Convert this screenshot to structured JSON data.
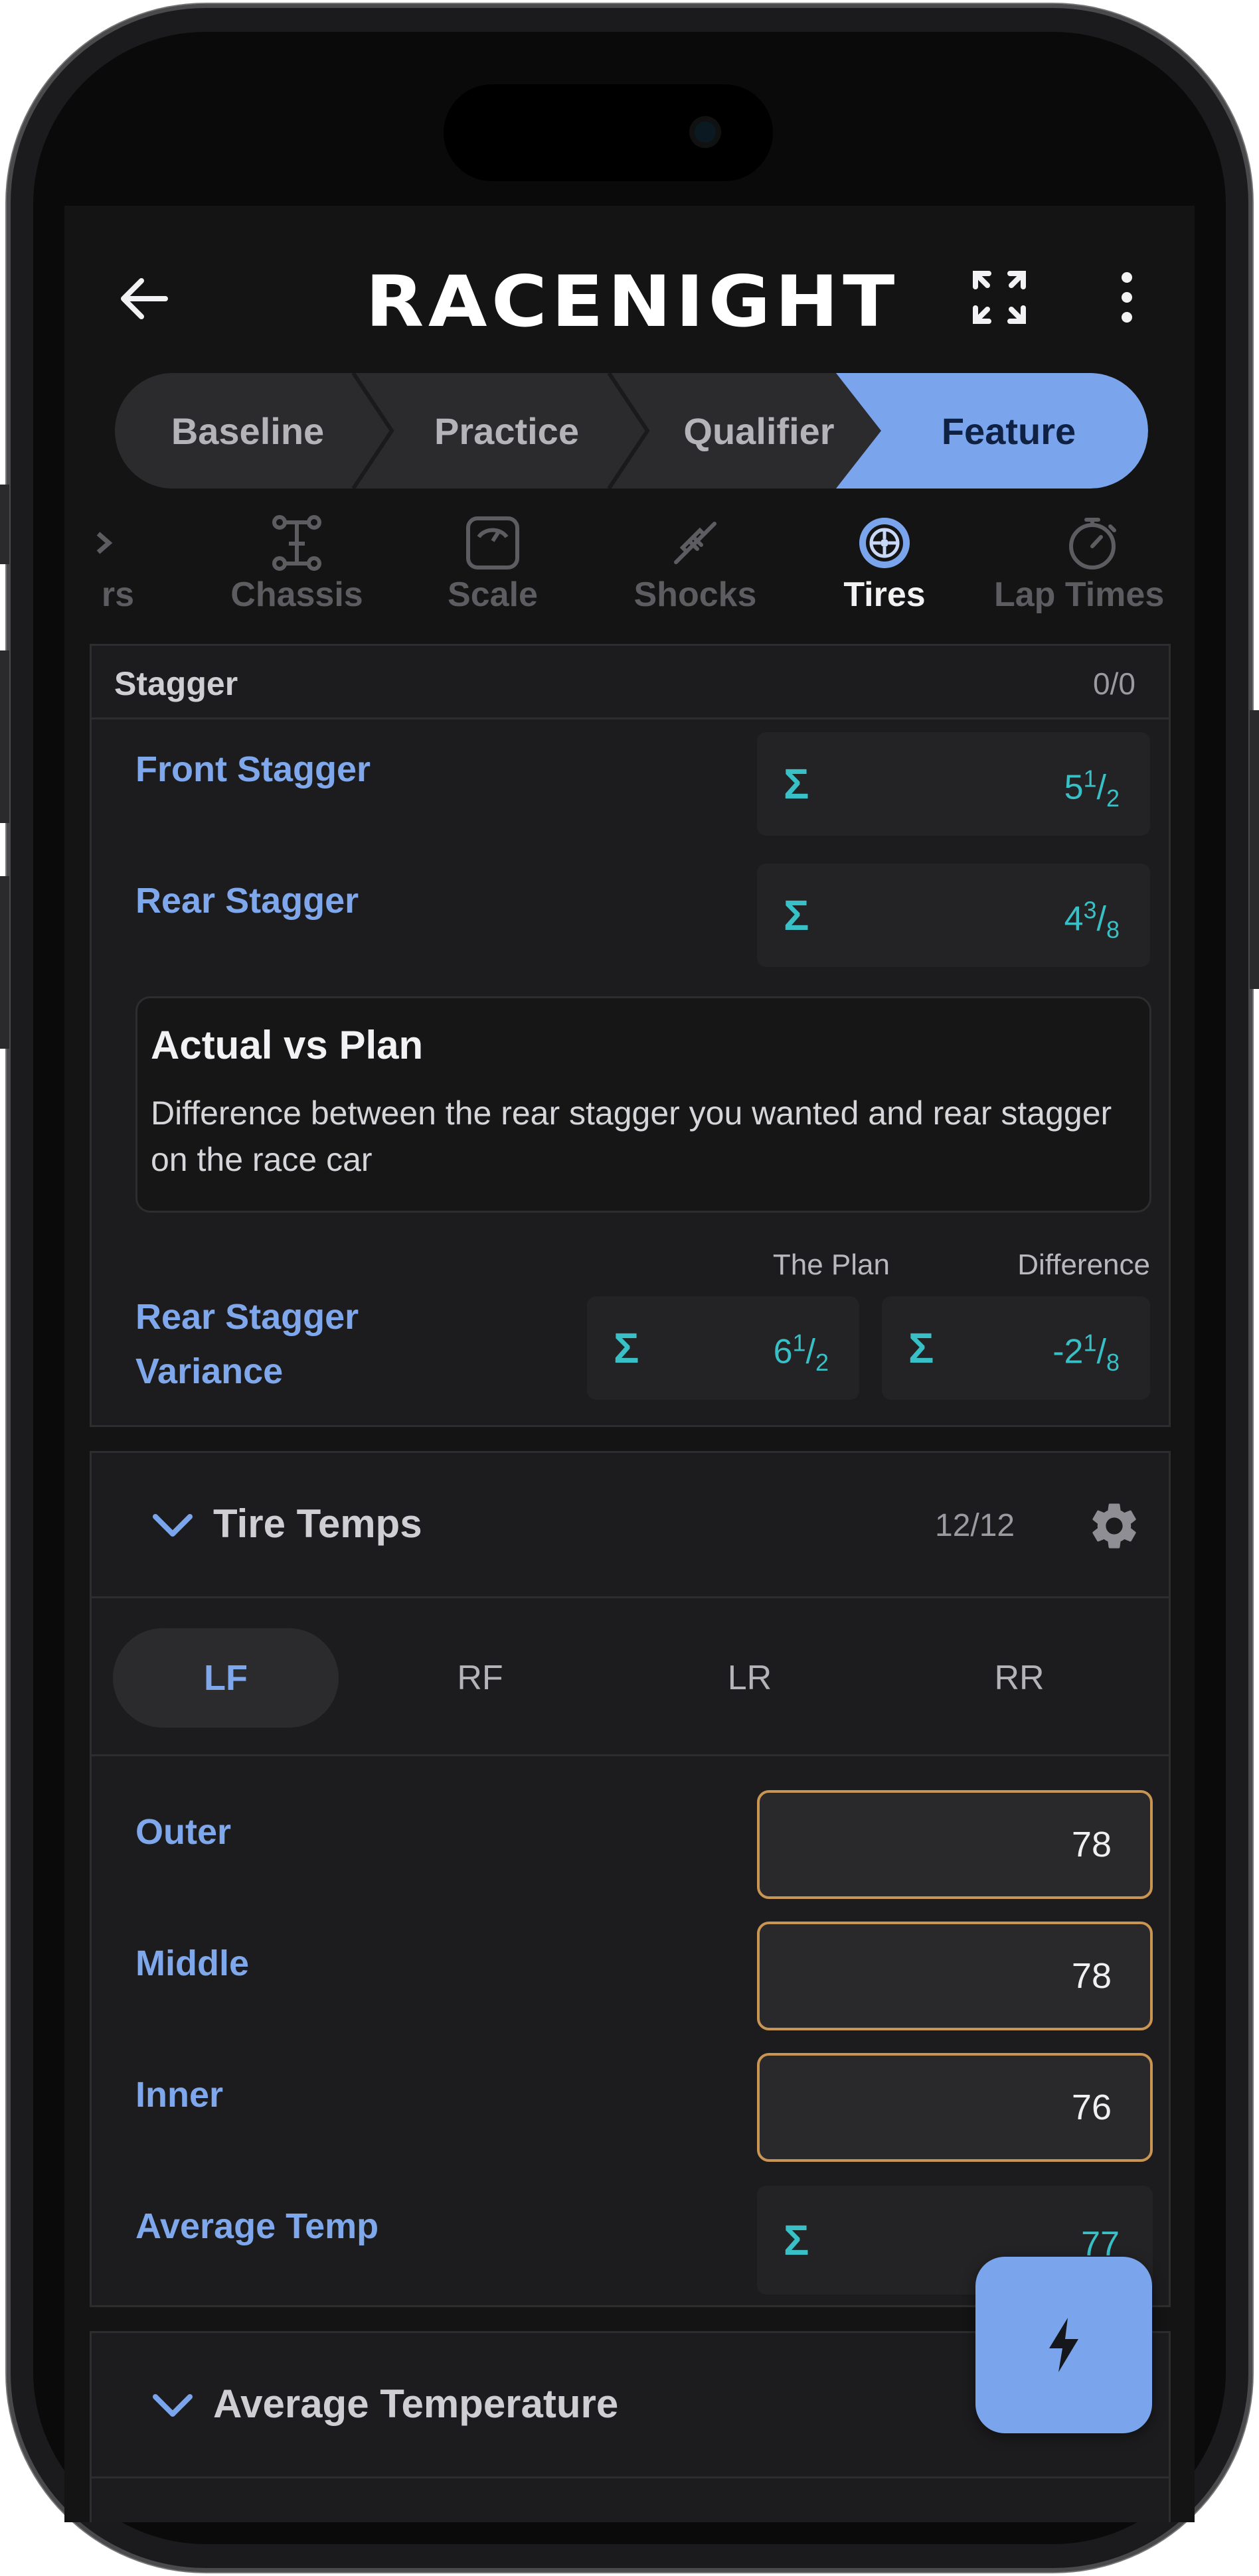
{
  "header": {
    "logo_text": "RACENIGHT",
    "back_icon": "arrow-left-icon",
    "expand_icon": "fullscreen-icon",
    "more_icon": "more-vertical-icon"
  },
  "breadcrumb": {
    "steps": [
      "Baseline",
      "Practice",
      "Qualifier",
      "Feature"
    ],
    "active": "Feature"
  },
  "tabs": {
    "items": [
      {
        "label": "rs",
        "icon": "chevron-right-icon"
      },
      {
        "label": "Chassis",
        "icon": "chassis-icon"
      },
      {
        "label": "Scale",
        "icon": "scale-icon"
      },
      {
        "label": "Shocks",
        "icon": "shock-icon"
      },
      {
        "label": "Tires",
        "icon": "tire-icon"
      },
      {
        "label": "Lap Times",
        "icon": "stopwatch-icon"
      }
    ],
    "active": "Tires"
  },
  "stagger": {
    "title": "Stagger",
    "count": "0/0",
    "front": {
      "label": "Front Stagger",
      "whole": "5",
      "num": "1",
      "den": "2"
    },
    "rear": {
      "label": "Rear Stagger",
      "whole": "4",
      "num": "3",
      "den": "8"
    },
    "note": {
      "title": "Actual vs Plan",
      "body": "Difference between the rear stagger you wanted and rear stagger on the race car"
    },
    "variance": {
      "label_line1": "Rear Stagger",
      "label_line2": "Variance",
      "plan_header": "The Plan",
      "diff_header": "Difference",
      "plan": {
        "whole": "6",
        "num": "1",
        "den": "2"
      },
      "diff": {
        "whole": "-2",
        "num": "1",
        "den": "8"
      }
    }
  },
  "tire_temps": {
    "title": "Tire Temps",
    "count": "12/12",
    "corners": [
      "LF",
      "RF",
      "LR",
      "RR"
    ],
    "active_corner": "LF",
    "rows": [
      {
        "label": "Outer",
        "value": "78"
      },
      {
        "label": "Middle",
        "value": "78"
      },
      {
        "label": "Inner",
        "value": "76"
      }
    ],
    "average": {
      "label": "Average Temp",
      "value": "77"
    }
  },
  "average_temperature": {
    "title": "Average Temperature"
  },
  "fab": {
    "icon": "lightning-bolt-icon"
  },
  "colors": {
    "accent": "#7aa5ec",
    "calc": "#39c0c7",
    "input_border": "#c99552",
    "background": "#141415"
  }
}
